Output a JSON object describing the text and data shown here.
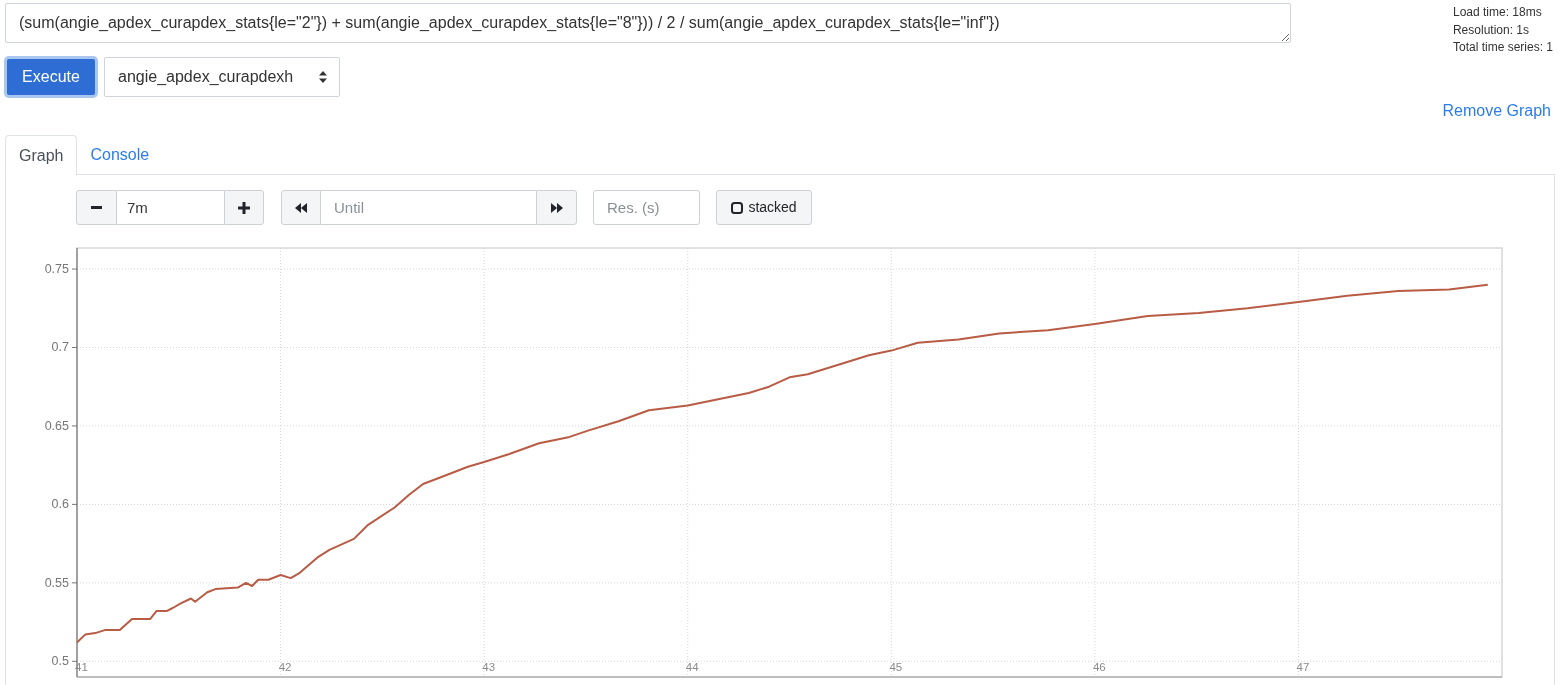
{
  "query": {
    "value": "(sum(angie_apdex_curapdex_stats{le=\"2\"}) + sum(angie_apdex_curapdex_stats{le=\"8\"})) / 2 / sum(angie_apdex_curapdex_stats{le=\"inf\"})"
  },
  "stats": [
    "Load time: 18ms",
    "Resolution: 1s",
    "Total time series: 1"
  ],
  "execute_button": "Execute",
  "metric_select": {
    "value": "angie_apdex_curapdexh"
  },
  "remove_graph_link": "Remove Graph",
  "tabs": [
    {
      "label": "Graph",
      "selected": true
    },
    {
      "label": "Console",
      "selected": false
    }
  ],
  "graph_controls": {
    "range": {
      "value": "7m"
    },
    "until": {
      "placeholder": "Until"
    },
    "resolution": {
      "placeholder": "Res. (s)"
    },
    "stacked": {
      "label": "stacked",
      "checked": false
    }
  },
  "graph": {
    "chart_data": {
      "type": "line",
      "grid": true,
      "x": [
        41,
        41.04,
        41.09,
        41.14,
        41.21,
        41.27,
        41.36,
        41.39,
        41.44,
        41.47,
        41.51,
        41.56,
        41.58,
        41.64,
        41.68,
        41.79,
        41.83,
        41.86,
        41.89,
        41.94,
        42,
        42.05,
        42.09,
        42.18,
        42.24,
        42.36,
        42.43,
        42.56,
        42.63,
        42.7,
        42.8,
        42.92,
        43,
        43.12,
        43.27,
        43.42,
        43.51,
        43.66,
        43.81,
        44,
        44.15,
        44.3,
        44.4,
        44.5,
        44.59,
        44.74,
        44.89,
        45,
        45.13,
        45.33,
        45.53,
        45.77,
        46,
        46.26,
        46.51,
        46.75,
        47,
        47.24,
        47.49,
        47.74,
        47.93
      ],
      "series": [
        {
          "color": "#b85c45",
          "values": [
            0.512,
            0.517,
            0.518,
            0.52,
            0.52,
            0.527,
            0.527,
            0.532,
            0.532,
            0.534,
            0.537,
            0.54,
            0.538,
            0.544,
            0.546,
            0.547,
            0.55,
            0.548,
            0.552,
            0.552,
            0.555,
            0.553,
            0.556,
            0.566,
            0.571,
            0.578,
            0.587,
            0.598,
            0.606,
            0.613,
            0.618,
            0.624,
            0.627,
            0.632,
            0.639,
            0.643,
            0.647,
            0.653,
            0.66,
            0.663,
            0.667,
            0.671,
            0.675,
            0.681,
            0.683,
            0.689,
            0.695,
            0.698,
            0.703,
            0.705,
            0.709,
            0.711,
            0.715,
            0.72,
            0.722,
            0.725,
            0.729,
            0.733,
            0.736,
            0.737,
            0.74
          ]
        }
      ],
      "xlim": [
        41,
        48
      ],
      "ylim": [
        0.49,
        0.7634
      ],
      "xticks": [
        41,
        42,
        43,
        44,
        45,
        46,
        47
      ],
      "yticks": [
        0.5,
        0.55,
        0.6,
        0.65,
        0.7,
        0.75
      ]
    }
  }
}
